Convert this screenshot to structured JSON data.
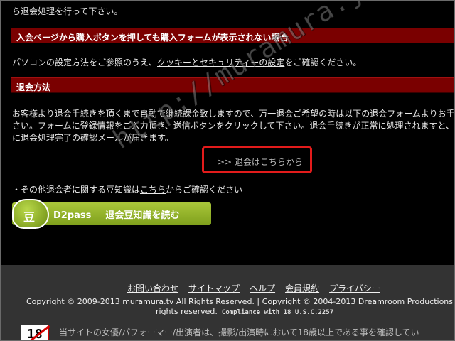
{
  "intro": {
    "top_line": "ら退会処理を行って下さい。"
  },
  "section1": {
    "heading": "入会ページから購入ボタンを押しても購入フォームが表示されない場合",
    "text_before": "パソコンの設定方法をご参照のうえ、",
    "link": "クッキーとセキュリティーの設定",
    "text_after": "をご確認ください。"
  },
  "section2": {
    "heading": "退会方法",
    "para_line1": "お客様より退会手続きを頂くまで自動で継続課金致しますので、万一退会ご希望の時は以下の退会フォームよりお手",
    "para_line2": "さい。フォームに登録情報をご入力頂き、送信ボタンをクリックして下さい。退会手続きが正常に処理されますと、お客",
    "para_line3": "に退会処理完了の確認メールが届きます。",
    "cta_link": ">> 退会はこちらから"
  },
  "tips": {
    "text_before": "・その他退会者に関する豆知識は",
    "link": "こちら",
    "text_after": "からご確認ください"
  },
  "banner": {
    "badge_char": "豆",
    "brand": "D2pass",
    "label": "退会豆知識を読む"
  },
  "footer": {
    "links": [
      "お問い合わせ",
      "サイトマップ",
      "ヘルプ",
      "会員規約",
      "プライバシー"
    ],
    "copyright_line1": "Copyright © 2009-2013 muramura.tv All Rights Reserved. | Copyright © 2004-2013 Dreamroom Productions",
    "copyright_line2": "rights reserved.",
    "compliance": "Compliance with 18 U.S.C.2257",
    "age_badge": "18",
    "age_note": "当サイトの女優/パフォーマー/出演者は、撮影/出演時において18歳以上である事を確認してい"
  },
  "watermark": "http://muramura.jp-adult.com",
  "colors": {
    "background": "#000000",
    "heading_bar": "#7a0000",
    "cta_border": "#e21b1b",
    "banner_green": "#8fb02a",
    "footer_bg": "#333333"
  }
}
